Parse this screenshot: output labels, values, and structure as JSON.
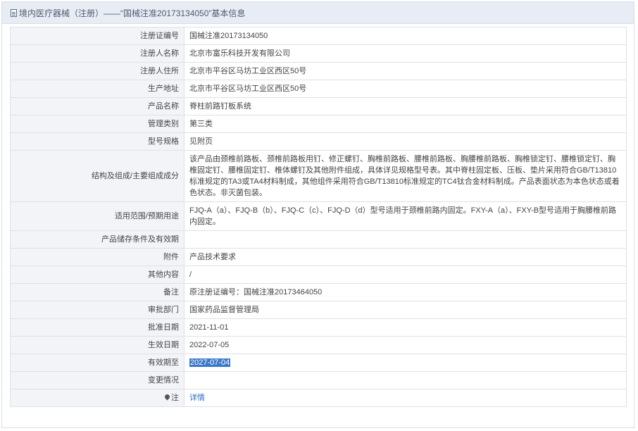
{
  "header": {
    "title": "境内医疗器械（注册）——“国械注准20173134050”基本信息",
    "icon": "document-icon"
  },
  "rows": [
    {
      "label": "注册证编号",
      "value": "国械注准20173134050"
    },
    {
      "label": "注册人名称",
      "value": "北京市富乐科技开发有限公司"
    },
    {
      "label": "注册人住所",
      "value": "北京市平谷区马坊工业区西区50号"
    },
    {
      "label": "生产地址",
      "value": "北京市平谷区马坊工业区西区50号"
    },
    {
      "label": "产品名称",
      "value": "脊柱前路钉板系统"
    },
    {
      "label": "管理类别",
      "value": "第三类"
    },
    {
      "label": "型号规格",
      "value": "见附页"
    },
    {
      "label": "结构及组成/主要组成成分",
      "value": "该产品由颈椎前路板、颈椎前路板用钉、修正螺钉、胸椎前路板、腰椎前路板、胸腰椎前路板、胸椎锁定钉、腰椎锁定钉、胸椎固定钉、腰椎固定钉、椎体螺钉及其他附件组成，具体详见规格型号表。其中脊柱固定板、压板、垫片采用符合GB/T13810标准规定的TA3或TA4材料制成，其他组件采用符合GB/T13810标准规定的TC4钛合金材料制成。产品表面状态为本色状态或着色状态。非灭菌包装。"
    },
    {
      "label": "适用范围/预期用途",
      "value": "FJQ-A（a）、FJQ-B（b）、FJQ-C（c）、FJQ-D（d）型号适用于颈椎前路内固定。FXY-A（a）、FXY-B型号适用于胸腰椎前路内固定。"
    },
    {
      "label": "产品储存条件及有效期",
      "value": ""
    },
    {
      "label": "附件",
      "value": "产品技术要求"
    },
    {
      "label": "其他内容",
      "value": "/"
    },
    {
      "label": "备注",
      "value": "原注册证编号：国械注准20173464050"
    },
    {
      "label": "审批部门",
      "value": "国家药品监督管理局"
    },
    {
      "label": "批准日期",
      "value": "2021-11-01"
    },
    {
      "label": "生效日期",
      "value": "2022-07-05"
    },
    {
      "label": "有效期至",
      "value": "2027-07-04"
    },
    {
      "label": "变更情况",
      "value": ""
    },
    {
      "label": "注",
      "value": "详情",
      "icon": "pin-icon"
    }
  ],
  "colors": {
    "header_bg": "#e8edf5",
    "label_bg": "#f2f4f7",
    "border": "#dde1e7",
    "link": "#2b6cc4",
    "selection": "#3a78c9"
  }
}
